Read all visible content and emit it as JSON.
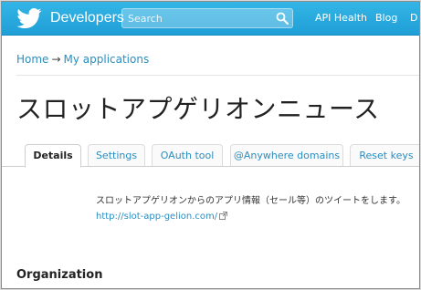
{
  "header": {
    "brand": "Developers",
    "search": {
      "placeholder": "Search"
    },
    "nav": [
      "API Health",
      "Blog",
      "D"
    ]
  },
  "breadcrumb": {
    "home": "Home",
    "separator": "→",
    "current": "My applications"
  },
  "page": {
    "title": "スロットアプゲリオンニュース"
  },
  "tabs": [
    "Details",
    "Settings",
    "OAuth tool",
    "@Anywhere domains",
    "Reset keys"
  ],
  "details": {
    "description": "スロットアプゲリオンからのアプリ情報（セール等）のツイートをします。",
    "url": "http://slot-app-gelion.com/"
  },
  "sections": {
    "organization": "Organization"
  },
  "colors": {
    "topbar": "#2aaee2",
    "link": "#2a8ec0"
  },
  "icons": {
    "logo": "twitter-bird-icon",
    "search": "search-icon",
    "external": "external-link-icon"
  }
}
